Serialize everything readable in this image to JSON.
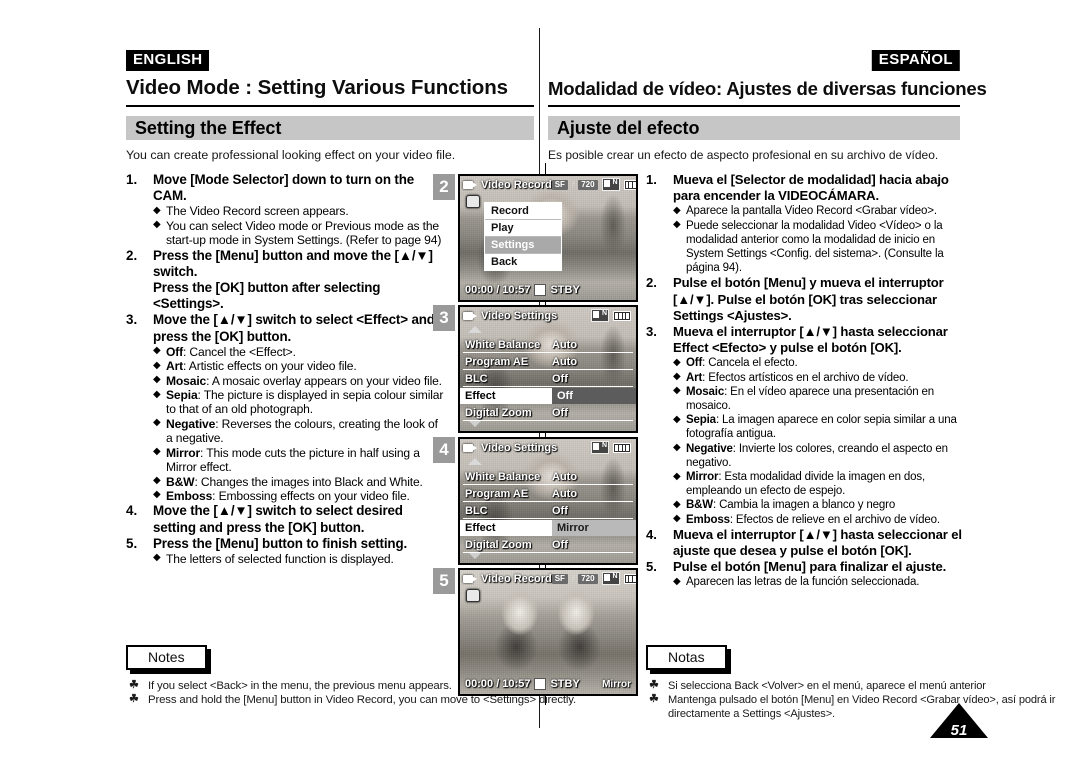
{
  "page_number": "51",
  "colors": {
    "band_gray": "#c6c6c6",
    "badge_black": "#000000",
    "chip_gray": "#9a9a9a"
  },
  "english": {
    "lang_badge": "ENGLISH",
    "chapter_title": "Video Mode : Setting Various Functions",
    "section_title": "Setting the Effect",
    "intro": "You can create professional looking effect on your video file.",
    "steps": [
      {
        "num": "1.",
        "title": "Move [Mode Selector] down to turn on the CAM.",
        "bullets": [
          {
            "lead": "",
            "text": "The Video Record screen appears."
          },
          {
            "lead": "",
            "text": "You can select Video mode or Previous mode as the start-up mode in System Settings. (Refer to page 94)"
          }
        ]
      },
      {
        "num": "2.",
        "title": "Press the [Menu] button and move the [▲/▼] switch.\nPress the [OK] button after selecting <Settings>.",
        "bullets": []
      },
      {
        "num": "3.",
        "title": "Move the [▲/▼] switch to select <Effect> and press the [OK] button.",
        "bullets": [
          {
            "lead": "Off",
            "text": ": Cancel the <Effect>."
          },
          {
            "lead": "Art",
            "text": ": Artistic effects on your video file."
          },
          {
            "lead": "Mosaic",
            "text": ": A mosaic overlay appears on your video file."
          },
          {
            "lead": "Sepia",
            "text": ": The picture is displayed in sepia colour similar to that of an old photograph."
          },
          {
            "lead": "Negative",
            "text": ": Reverses the colours, creating the look of a negative."
          },
          {
            "lead": "Mirror",
            "text": ": This mode cuts the picture in half using a Mirror effect."
          },
          {
            "lead": "B&W",
            "text": ": Changes the images into Black and White."
          },
          {
            "lead": "Emboss",
            "text": ": Embossing effects on your video file."
          }
        ]
      },
      {
        "num": "4.",
        "title": "Move the [▲/▼] switch to select desired setting and press the [OK] button.",
        "bullets": []
      },
      {
        "num": "5.",
        "title": "Press the [Menu] button to finish setting.",
        "bullets": [
          {
            "lead": "",
            "text": "The letters of selected function is displayed."
          }
        ]
      }
    ],
    "notes_label": "Notes",
    "notes": [
      "If you select <Back> in the menu, the previous menu appears.",
      "Press and hold the [Menu] button in Video Record, you can move to <Settings> directly."
    ]
  },
  "spanish": {
    "lang_badge": "ESPAÑOL",
    "chapter_title": "Modalidad de vídeo: Ajustes de diversas funciones",
    "section_title": "Ajuste del efecto",
    "intro": "Es posible crear un efecto de aspecto profesional en su archivo de vídeo.",
    "steps": [
      {
        "num": "1.",
        "title": "Mueva el [Selector de modalidad] hacia abajo para encender la VIDEOCÁMARA.",
        "bullets": [
          {
            "lead": "",
            "text": "Aparece la pantalla Video Record <Grabar vídeo>."
          },
          {
            "lead": "",
            "text": "Puede seleccionar la modalidad Video <Vídeo> o la modalidad anterior como la modalidad de inicio en System Settings <Config. del sistema>. (Consulte la página 94)."
          }
        ]
      },
      {
        "num": "2.",
        "title": "Pulse el botón [Menu] y mueva el interruptor [▲/▼]. Pulse el botón [OK] tras seleccionar Settings <Ajustes>.",
        "bullets": []
      },
      {
        "num": "3.",
        "title": "Mueva el interruptor [▲/▼] hasta seleccionar Effect <Efecto> y pulse el botón [OK].",
        "bullets": [
          {
            "lead": "Off",
            "text": ": Cancela el efecto."
          },
          {
            "lead": "Art",
            "text": ": Efectos artísticos en el archivo de vídeo."
          },
          {
            "lead": "Mosaic",
            "text": ": En el vídeo aparece una presentación en mosaico."
          },
          {
            "lead": "Sepia",
            "text": ": La imagen aparece en color sepia similar a una fotografía antigua."
          },
          {
            "lead": "Negative",
            "text": ": Invierte los colores, creando el aspecto en negativo."
          },
          {
            "lead": "Mirror",
            "text": ": Esta modalidad divide la imagen en dos, empleando un efecto de espejo."
          },
          {
            "lead": "B&W",
            "text": ": Cambia la imagen a blanco y negro"
          },
          {
            "lead": "Emboss",
            "text": ": Efectos de relieve en el archivo de vídeo."
          }
        ]
      },
      {
        "num": "4.",
        "title": "Mueva el interruptor [▲/▼] hasta seleccionar el ajuste que desea y pulse el botón [OK].",
        "bullets": []
      },
      {
        "num": "5.",
        "title": "Pulse el botón [Menu] para finalizar el ajuste.",
        "bullets": [
          {
            "lead": "",
            "text": "Aparecen las letras de la función seleccionada."
          }
        ]
      }
    ],
    "notes_label": "Notas",
    "notes": [
      "Si selecciona Back <Volver> en el menú, aparece el menú anterior",
      "Mantenga pulsado el botón [Menu] en Video Record <Grabar vídeo>, así podrá ir directamente a Settings <Ajustes>."
    ]
  },
  "screens": [
    {
      "step_chip": "2",
      "osd_title": "Video Record",
      "quality": "SF",
      "resolution": "720",
      "timecode": "00:00 / 10:57",
      "status": "STBY",
      "menu_type": "popup",
      "popup_items": [
        {
          "label": "Record",
          "selected": false
        },
        {
          "label": "Play",
          "selected": false
        },
        {
          "label": "Settings",
          "selected": true
        },
        {
          "label": "Back",
          "selected": false
        }
      ]
    },
    {
      "step_chip": "3",
      "osd_title": "Video Settings",
      "menu_type": "settings",
      "rows": [
        {
          "label": "White Balance",
          "value": "Auto",
          "highlighted": false
        },
        {
          "label": "Program AE",
          "value": "Auto",
          "highlighted": false
        },
        {
          "label": "BLC",
          "value": "Off",
          "highlighted": false
        },
        {
          "label": "Effect",
          "value": "Off",
          "highlighted": true
        },
        {
          "label": "Digital Zoom",
          "value": "Off",
          "highlighted": false
        }
      ]
    },
    {
      "step_chip": "4",
      "osd_title": "Video Settings",
      "menu_type": "settings",
      "rows": [
        {
          "label": "White Balance",
          "value": "Auto",
          "highlighted": false
        },
        {
          "label": "Program AE",
          "value": "Auto",
          "highlighted": false
        },
        {
          "label": "BLC",
          "value": "Off",
          "highlighted": false
        },
        {
          "label": "Effect",
          "value": "Mirror",
          "highlighted": true
        },
        {
          "label": "Digital Zoom",
          "value": "Off",
          "highlighted": false
        }
      ]
    },
    {
      "step_chip": "5",
      "osd_title": "Video Record",
      "quality": "SF",
      "resolution": "720",
      "timecode": "00:00 / 10:57",
      "status": "STBY",
      "effect_tag": "Mirror",
      "menu_type": "none"
    }
  ]
}
